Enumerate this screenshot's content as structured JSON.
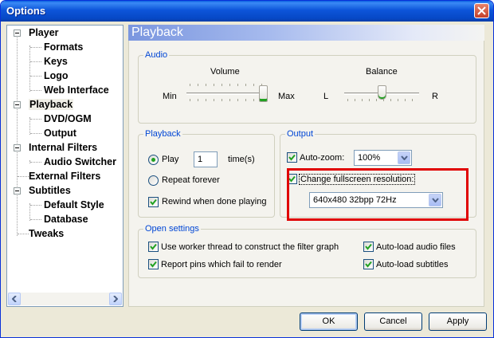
{
  "window": {
    "title": "Options"
  },
  "tree": {
    "items": [
      {
        "label": "Player"
      },
      {
        "label": "Formats"
      },
      {
        "label": "Keys"
      },
      {
        "label": "Logo"
      },
      {
        "label": "Web Interface"
      },
      {
        "label": "Playback"
      },
      {
        "label": "DVD/OGM"
      },
      {
        "label": "Output"
      },
      {
        "label": "Internal Filters"
      },
      {
        "label": "Audio Switcher"
      },
      {
        "label": "External Filters"
      },
      {
        "label": "Subtitles"
      },
      {
        "label": "Default Style"
      },
      {
        "label": "Database"
      },
      {
        "label": "Tweaks"
      }
    ],
    "selected": "Playback"
  },
  "page": {
    "title": "Playback"
  },
  "audio": {
    "group_title": "Audio",
    "volume_label": "Volume",
    "volume_min": "Min",
    "volume_max": "Max",
    "volume_level": 1.0,
    "balance_label": "Balance",
    "balance_left": "L",
    "balance_right": "R",
    "balance_level": 0.5
  },
  "playback": {
    "group_title": "Playback",
    "play_label": "Play",
    "play_count": "1",
    "times_label": "time(s)",
    "repeat_label": "Repeat forever",
    "rewind_label": "Rewind when done playing",
    "play_selected": true,
    "rewind_checked": true
  },
  "output": {
    "group_title": "Output",
    "autozoom_label": "Auto-zoom:",
    "autozoom_checked": true,
    "autozoom_value": "100%",
    "fullscreen_label": "Change fullscreen resolution:",
    "fullscreen_checked": true,
    "fullscreen_value": "640x480 32bpp 72Hz"
  },
  "open_settings": {
    "group_title": "Open settings",
    "worker_thread_label": "Use worker thread to construct the filter graph",
    "report_pins_label": "Report pins which fail to render",
    "autoload_audio_label": "Auto-load audio files",
    "autoload_subtitles_label": "Auto-load subtitles"
  },
  "buttons": {
    "ok": "OK",
    "cancel": "Cancel",
    "apply": "Apply"
  },
  "colors": {
    "highlight": "#e00000",
    "group_title": "#0046d5",
    "title_bar": "#0a55d9"
  }
}
